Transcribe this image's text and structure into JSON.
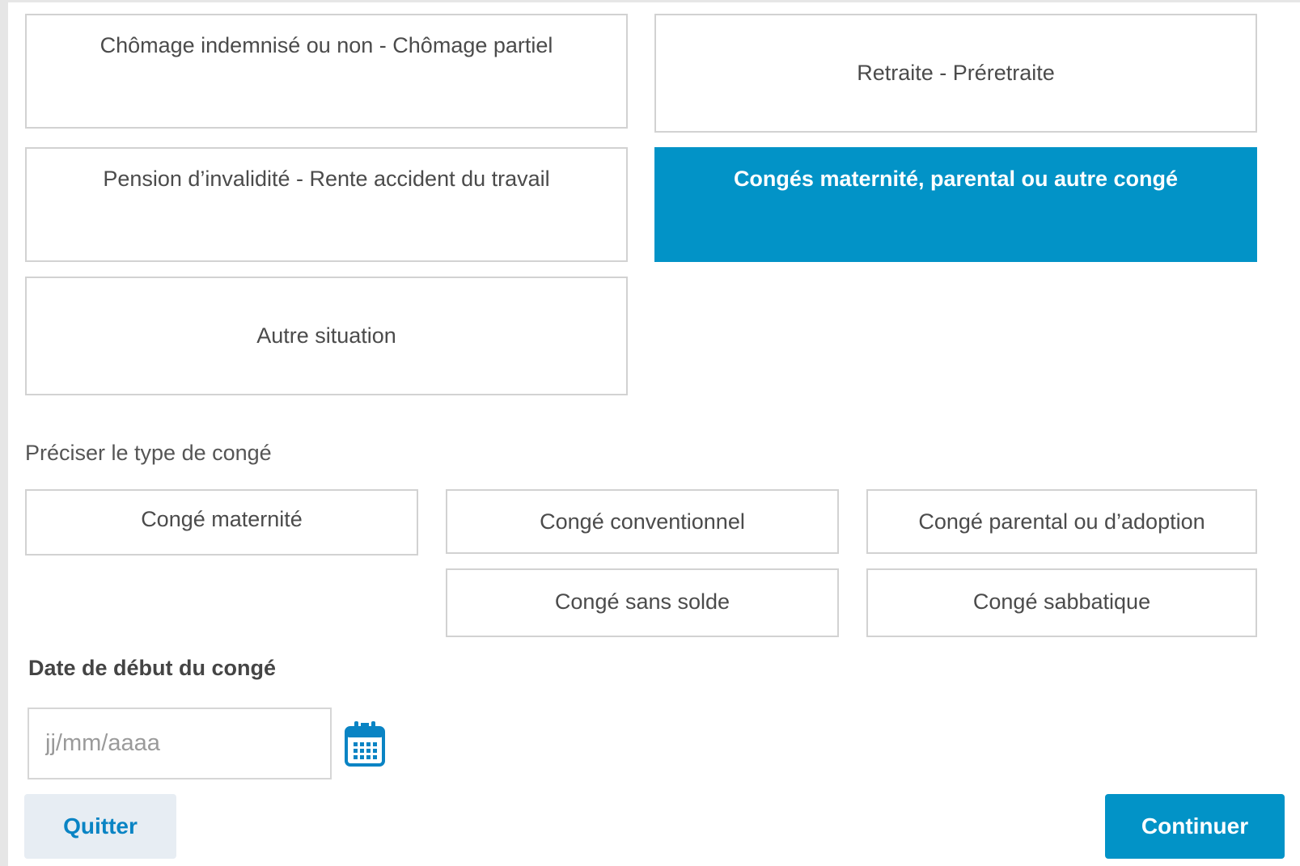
{
  "situations": {
    "chomage": "Chômage indemnisé ou non - Chômage partiel",
    "retraite": "Retraite - Préretraite",
    "invalidite": "Pension d’invalidité - Rente accident du travail",
    "conges": "Congés maternité, parental ou autre congé",
    "autre": "Autre situation",
    "selected": "Congés maternité, parental ou autre congé"
  },
  "leave_type": {
    "label": "Préciser le type de congé",
    "maternite": "Congé maternité",
    "conventionnel": "Congé conventionnel",
    "parental": "Congé parental ou d’adoption",
    "sans_solde": "Congé sans solde",
    "sabbatique": "Congé sabbatique"
  },
  "start_date": {
    "label": "Date de début du congé",
    "placeholder": "jj/mm/aaaa",
    "value": ""
  },
  "actions": {
    "quit_label": "Quitter",
    "continue_label": "Continuer"
  },
  "colors": {
    "accent": "#0293c7",
    "link": "#0a84c4",
    "quit_bg": "#e7edf3",
    "border": "#d2d2d2"
  },
  "icons": {
    "calendar": "calendar-icon"
  }
}
